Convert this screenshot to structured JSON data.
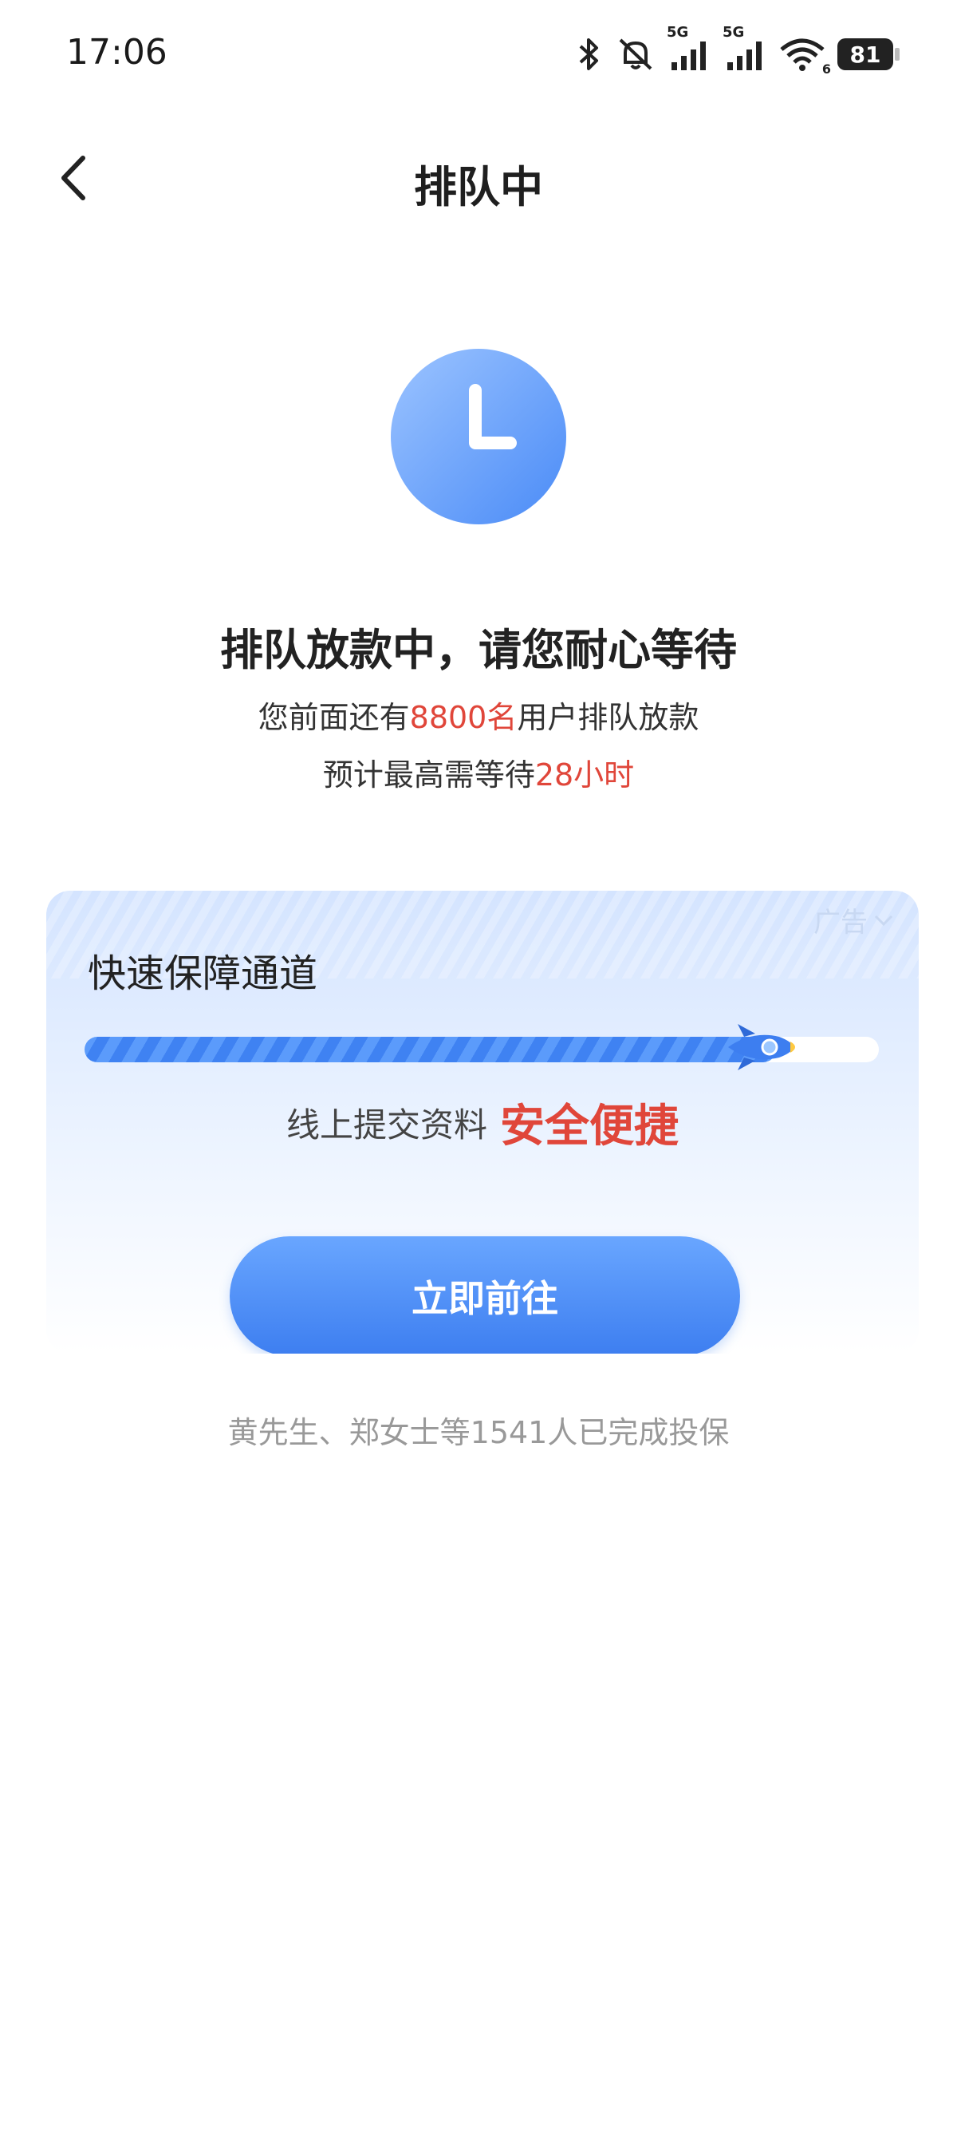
{
  "status_bar": {
    "time": "17:06",
    "battery": "81",
    "icons": [
      "bluetooth-icon",
      "mute-icon",
      "signal-5g-icon",
      "signal-5g-icon",
      "wifi-icon",
      "battery-icon"
    ],
    "network_label_1": "5G",
    "network_label_2": "5G",
    "wifi_label": "6"
  },
  "nav": {
    "title": "排队中",
    "back_icon": "chevron-left-icon"
  },
  "status": {
    "icon": "clock-icon",
    "headline": "排队放款中，请您耐心等待",
    "line1_prefix": "您前面还有",
    "line1_highlight": "8800名",
    "line1_suffix": "用户排队放款",
    "line2_prefix": "预计最高需等待",
    "line2_highlight": "28小时"
  },
  "ad_card": {
    "ad_label": "广告",
    "title": "快速保障通道",
    "progress": 0.87,
    "slogan_plain": "线上提交资料",
    "slogan_accent": "安全便捷",
    "button_label": "立即前往"
  },
  "footnote": "黄先生、郑女士等1541人已完成投保",
  "colors": {
    "accent_blue": "#4a8bf7",
    "highlight_red": "#e0463a"
  }
}
